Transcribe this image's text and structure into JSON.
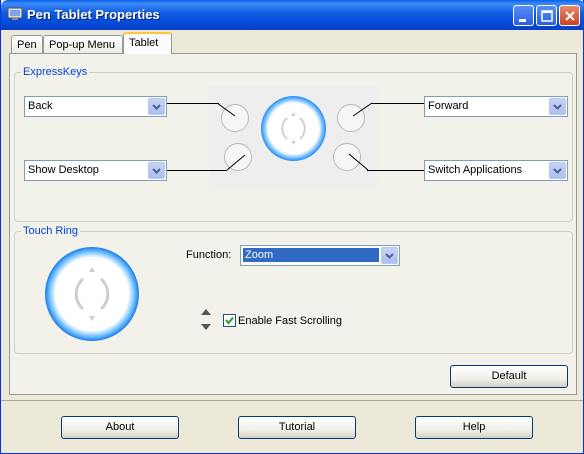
{
  "window": {
    "title": "Pen Tablet Properties"
  },
  "tabs": [
    {
      "label": "Pen"
    },
    {
      "label": "Pop-up Menu"
    },
    {
      "label": "Tablet"
    }
  ],
  "expresskeys": {
    "group_label": "ExpressKeys",
    "top_left": "Back",
    "bottom_left": "Show Desktop",
    "top_right": "Forward",
    "bottom_right": "Switch Applications"
  },
  "touch_ring": {
    "group_label": "Touch Ring",
    "function_label": "Function:",
    "function_value": "Zoom",
    "fast_scroll_label": "Enable Fast Scrolling",
    "fast_scroll_checked": true
  },
  "buttons": {
    "default": "Default",
    "about": "About",
    "tutorial": "Tutorial",
    "help": "Help"
  },
  "colors": {
    "accent": "#0046d5",
    "ring_glow": "#1e90ff"
  }
}
